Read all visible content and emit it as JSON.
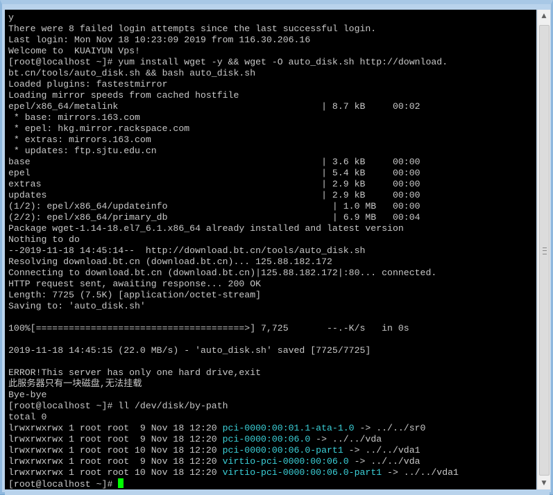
{
  "terminal": {
    "lines": [
      {
        "text": "y"
      },
      {
        "text": "There were 8 failed login attempts since the last successful login."
      },
      {
        "text": "Last login: Mon Nov 18 10:23:09 2019 from 116.30.206.16"
      },
      {
        "text": "Welcome to  KUAIYUN Vps!"
      },
      {
        "text": "[root@localhost ~]# yum install wget -y && wget -O auto_disk.sh http://download."
      },
      {
        "text": "bt.cn/tools/auto_disk.sh && bash auto_disk.sh"
      },
      {
        "text": "Loaded plugins: fastestmirror"
      },
      {
        "text": "Loading mirror speeds from cached hostfile"
      },
      {
        "text": "epel/x86_64/metalink                                     | 8.7 kB     00:02"
      },
      {
        "text": " * base: mirrors.163.com"
      },
      {
        "text": " * epel: hkg.mirror.rackspace.com"
      },
      {
        "text": " * extras: mirrors.163.com"
      },
      {
        "text": " * updates: ftp.sjtu.edu.cn"
      },
      {
        "text": "base                                                     | 3.6 kB     00:00"
      },
      {
        "text": "epel                                                     | 5.4 kB     00:00"
      },
      {
        "text": "extras                                                   | 2.9 kB     00:00"
      },
      {
        "text": "updates                                                  | 2.9 kB     00:00"
      },
      {
        "text": "(1/2): epel/x86_64/updateinfo                              | 1.0 MB   00:00"
      },
      {
        "text": "(2/2): epel/x86_64/primary_db                              | 6.9 MB   00:04"
      },
      {
        "text": "Package wget-1.14-18.el7_6.1.x86_64 already installed and latest version"
      },
      {
        "text": "Nothing to do"
      },
      {
        "text": "--2019-11-18 14:45:14--  http://download.bt.cn/tools/auto_disk.sh"
      },
      {
        "text": "Resolving download.bt.cn (download.bt.cn)... 125.88.182.172"
      },
      {
        "text": "Connecting to download.bt.cn (download.bt.cn)|125.88.182.172|:80... connected."
      },
      {
        "text": "HTTP request sent, awaiting response... 200 OK"
      },
      {
        "text": "Length: 7725 (7.5K) [application/octet-stream]"
      },
      {
        "text": "Saving to: 'auto_disk.sh'"
      },
      {
        "text": ""
      },
      {
        "text": "100%[======================================>] 7,725       --.-K/s   in 0s"
      },
      {
        "text": ""
      },
      {
        "text": "2019-11-18 14:45:15 (22.0 MB/s) - 'auto_disk.sh' saved [7725/7725]"
      },
      {
        "text": ""
      },
      {
        "text": "ERROR!This server has only one hard drive,exit"
      },
      {
        "text": "此服务器只有一块磁盘,无法挂载"
      },
      {
        "text": "Bye-bye"
      },
      {
        "text": "[root@localhost ~]# ll /dev/disk/by-path"
      },
      {
        "text": "total 0"
      },
      {
        "text": "lrwxrwxrwx 1 root root  9 Nov 18 12:20 ",
        "link": "pci-0000:00:01.1-ata-1.0",
        "target": " -> ../../sr0"
      },
      {
        "text": "lrwxrwxrwx 1 root root  9 Nov 18 12:20 ",
        "link": "pci-0000:00:06.0",
        "target": " -> ../../vda"
      },
      {
        "text": "lrwxrwxrwx 1 root root 10 Nov 18 12:20 ",
        "link": "pci-0000:00:06.0-part1",
        "target": " -> ../../vda1"
      },
      {
        "text": "lrwxrwxrwx 1 root root  9 Nov 18 12:20 ",
        "link": "virtio-pci-0000:00:06.0",
        "target": " -> ../../vda"
      },
      {
        "text": "lrwxrwxrwx 1 root root 10 Nov 18 12:20 ",
        "link": "virtio-pci-0000:00:06.0-part1",
        "target": " -> ../../vda1"
      }
    ],
    "prompt": "[root@localhost ~]# ",
    "colors": {
      "background": "#000000",
      "text": "#c8c8c8",
      "link": "#3bd0d8",
      "cursor": "#00ff00"
    }
  },
  "scrollbar": {
    "up_icon": "scroll-up-arrow-icon",
    "down_icon": "scroll-down-arrow-icon"
  }
}
